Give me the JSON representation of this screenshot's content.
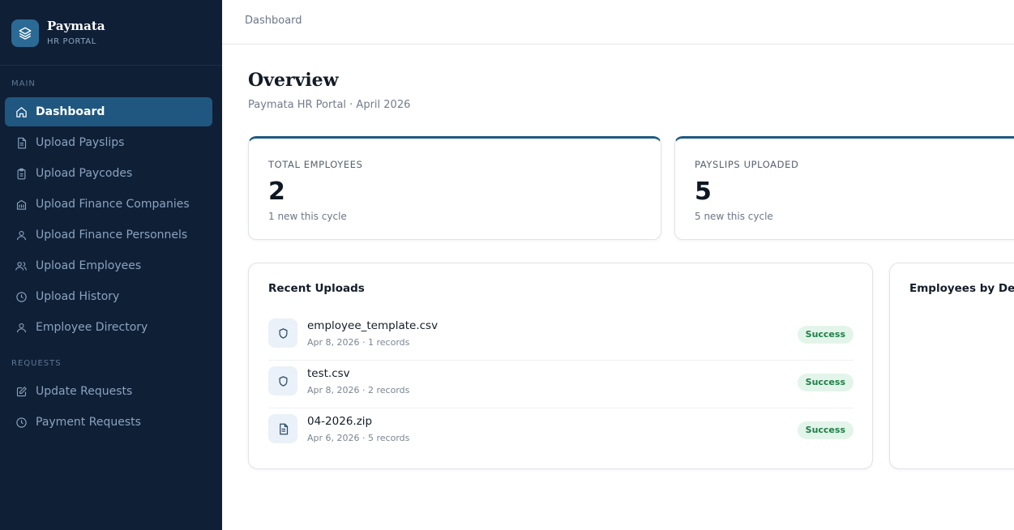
{
  "brand": {
    "name": "Paymata",
    "subtitle": "HR PORTAL",
    "logo_icon": "layers-icon"
  },
  "sidebar": {
    "sections": [
      {
        "label": "MAIN",
        "items": [
          {
            "label": "Dashboard",
            "icon": "home-icon",
            "active": true
          },
          {
            "label": "Upload Payslips",
            "icon": "document-icon"
          },
          {
            "label": "Upload Paycodes",
            "icon": "clipboard-icon"
          },
          {
            "label": "Upload Finance Companies",
            "icon": "building-icon"
          },
          {
            "label": "Upload Finance Personnels",
            "icon": "user-icon"
          },
          {
            "label": "Upload Employees",
            "icon": "users-icon"
          },
          {
            "label": "Upload History",
            "icon": "clock-icon"
          },
          {
            "label": "Employee Directory",
            "icon": "user-icon"
          }
        ]
      },
      {
        "label": "REQUESTS",
        "items": [
          {
            "label": "Update Requests",
            "icon": "edit-icon"
          },
          {
            "label": "Payment Requests",
            "icon": "clock-icon"
          }
        ]
      }
    ]
  },
  "topbar": {
    "breadcrumb": "Dashboard"
  },
  "page": {
    "title": "Overview",
    "subtitle": "Paymata HR Portal · April 2026"
  },
  "stats": [
    {
      "label": "TOTAL EMPLOYEES",
      "value": "2",
      "note": "1 new this cycle"
    },
    {
      "label": "PAYSLIPS UPLOADED",
      "value": "5",
      "note": "5 new this cycle"
    }
  ],
  "recent_uploads": {
    "title": "Recent Uploads",
    "items": [
      {
        "name": "employee_template.csv",
        "meta": "Apr 8, 2026 · 1 records",
        "status": "Success",
        "icon": "shield-icon"
      },
      {
        "name": "test.csv",
        "meta": "Apr 8, 2026 · 2 records",
        "status": "Success",
        "icon": "shield-icon"
      },
      {
        "name": "04-2026.zip",
        "meta": "Apr 6, 2026 · 5 records",
        "status": "Success",
        "icon": "document-icon"
      }
    ]
  },
  "department_panel": {
    "title": "Employees by Depa"
  },
  "colors": {
    "sidebar_bg": "#0f1f36",
    "active_item": "#1f5780",
    "accent": "#1e5a82",
    "success_bg": "#e3f5ea",
    "success_text": "#1d7f46"
  }
}
